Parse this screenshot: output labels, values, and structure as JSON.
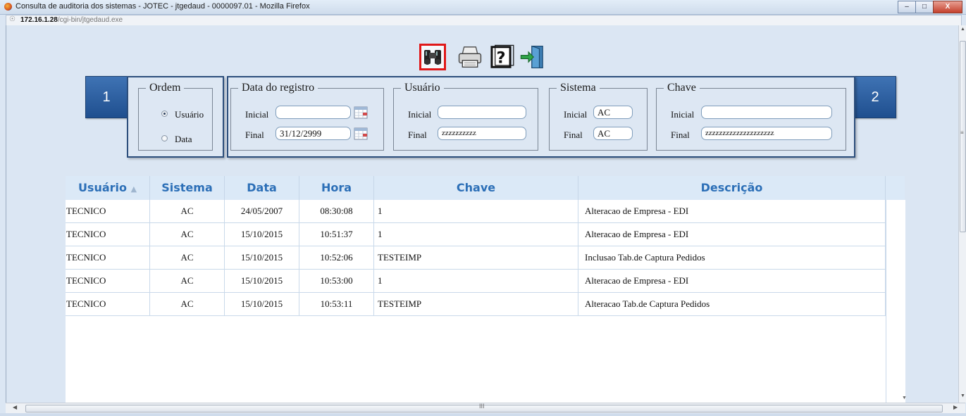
{
  "window": {
    "title": "Consulta de auditoria dos sistemas - JOTEC - jtgedaud - 0000097.01 - Mozilla Firefox",
    "minimize": "–",
    "maximize": "□",
    "close": "X"
  },
  "urlbar": {
    "host": "172.16.1.28",
    "path": "/cgi-bin/jtgedaud.exe"
  },
  "toolbar": {
    "icons": [
      "binoculars-icon",
      "printer-icon",
      "help-icon",
      "exit-icon"
    ],
    "selected": "binoculars-icon",
    "selected_color": "#e01818"
  },
  "badges": {
    "left": "1",
    "right": "2"
  },
  "filters": {
    "ordem": {
      "legend": "Ordem",
      "options": [
        "Usuário",
        "Data"
      ],
      "selected": "Usuário"
    },
    "data_registro": {
      "legend": "Data do registro",
      "inicial_label": "Inicial",
      "inicial_value": "",
      "final_label": "Final",
      "final_value": "31/12/2999"
    },
    "usuario": {
      "legend": "Usuário",
      "inicial_label": "Inicial",
      "inicial_value": "",
      "final_label": "Final",
      "final_value": "zzzzzzzzzz"
    },
    "sistema": {
      "legend": "Sistema",
      "inicial_label": "Inicial",
      "inicial_value": "AC",
      "final_label": "Final",
      "final_value": "AC"
    },
    "chave": {
      "legend": "Chave",
      "inicial_label": "Inicial",
      "inicial_value": "",
      "final_label": "Final",
      "final_value": "zzzzzzzzzzzzzzzzzzzz"
    }
  },
  "table": {
    "columns": [
      "Usuário",
      "Sistema",
      "Data",
      "Hora",
      "Chave",
      "Descrição"
    ],
    "sort_glyph": "▲",
    "header_color": "#2c6fb7",
    "rows": [
      {
        "usuario": "TECNICO",
        "sistema": "AC",
        "data": "24/05/2007",
        "hora": "08:30:08",
        "chave": "1",
        "descricao": "Alteracao de Empresa - EDI"
      },
      {
        "usuario": "TECNICO",
        "sistema": "AC",
        "data": "15/10/2015",
        "hora": "10:51:37",
        "chave": "1",
        "descricao": "Alteracao de Empresa - EDI"
      },
      {
        "usuario": "TECNICO",
        "sistema": "AC",
        "data": "15/10/2015",
        "hora": "10:52:06",
        "chave": "TESTEIMP",
        "descricao": "Inclusao Tab.de Captura Pedidos"
      },
      {
        "usuario": "TECNICO",
        "sistema": "AC",
        "data": "15/10/2015",
        "hora": "10:53:00",
        "chave": "1",
        "descricao": "Alteracao de Empresa - EDI"
      },
      {
        "usuario": "TECNICO",
        "sistema": "AC",
        "data": "15/10/2015",
        "hora": "10:53:11",
        "chave": "TESTEIMP",
        "descricao": "Alteracao Tab.de Captura Pedidos"
      }
    ]
  },
  "scroll": {
    "grip": "III",
    "up": "▲",
    "down": "▼",
    "left": "◀",
    "right": "▶"
  }
}
